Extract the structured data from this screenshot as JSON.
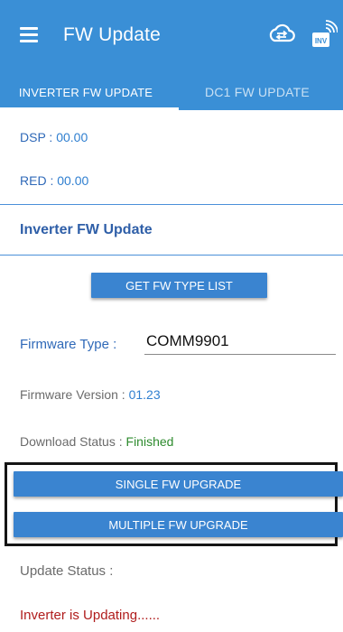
{
  "header": {
    "title": "FW Update",
    "icons": [
      "menu-icon",
      "cloud-sync-icon",
      "inverter-wifi-icon"
    ],
    "inv_badge_text": "INV"
  },
  "tabs": [
    {
      "label": "INVERTER FW UPDATE",
      "active": true
    },
    {
      "label": "DC1 FW UPDATE",
      "active": false
    }
  ],
  "versions": {
    "dsp_label": "DSP :",
    "dsp_value": "00.00",
    "red_label": "RED :",
    "red_value": "00.00"
  },
  "section": {
    "title": "Inverter FW Update",
    "get_list_button": "GET FW TYPE LIST",
    "firmware_type_label": "Firmware Type :",
    "firmware_type_value": "COMM9901",
    "firmware_version_label": "Firmware Version :",
    "firmware_version_value": "01.23",
    "download_status_label": "Download Status :",
    "download_status_value": "Finished",
    "single_upgrade_button": "SINGLE FW UPGRADE",
    "multiple_upgrade_button": "MULTIPLE FW UPGRADE",
    "update_status_label": "Update Status :",
    "update_status_value": "Inverter is Updating......"
  },
  "colors": {
    "primary": "#3a8fd6",
    "button": "#3a84d0",
    "status_green": "#2e8b2e",
    "status_red": "#b01c1c"
  }
}
